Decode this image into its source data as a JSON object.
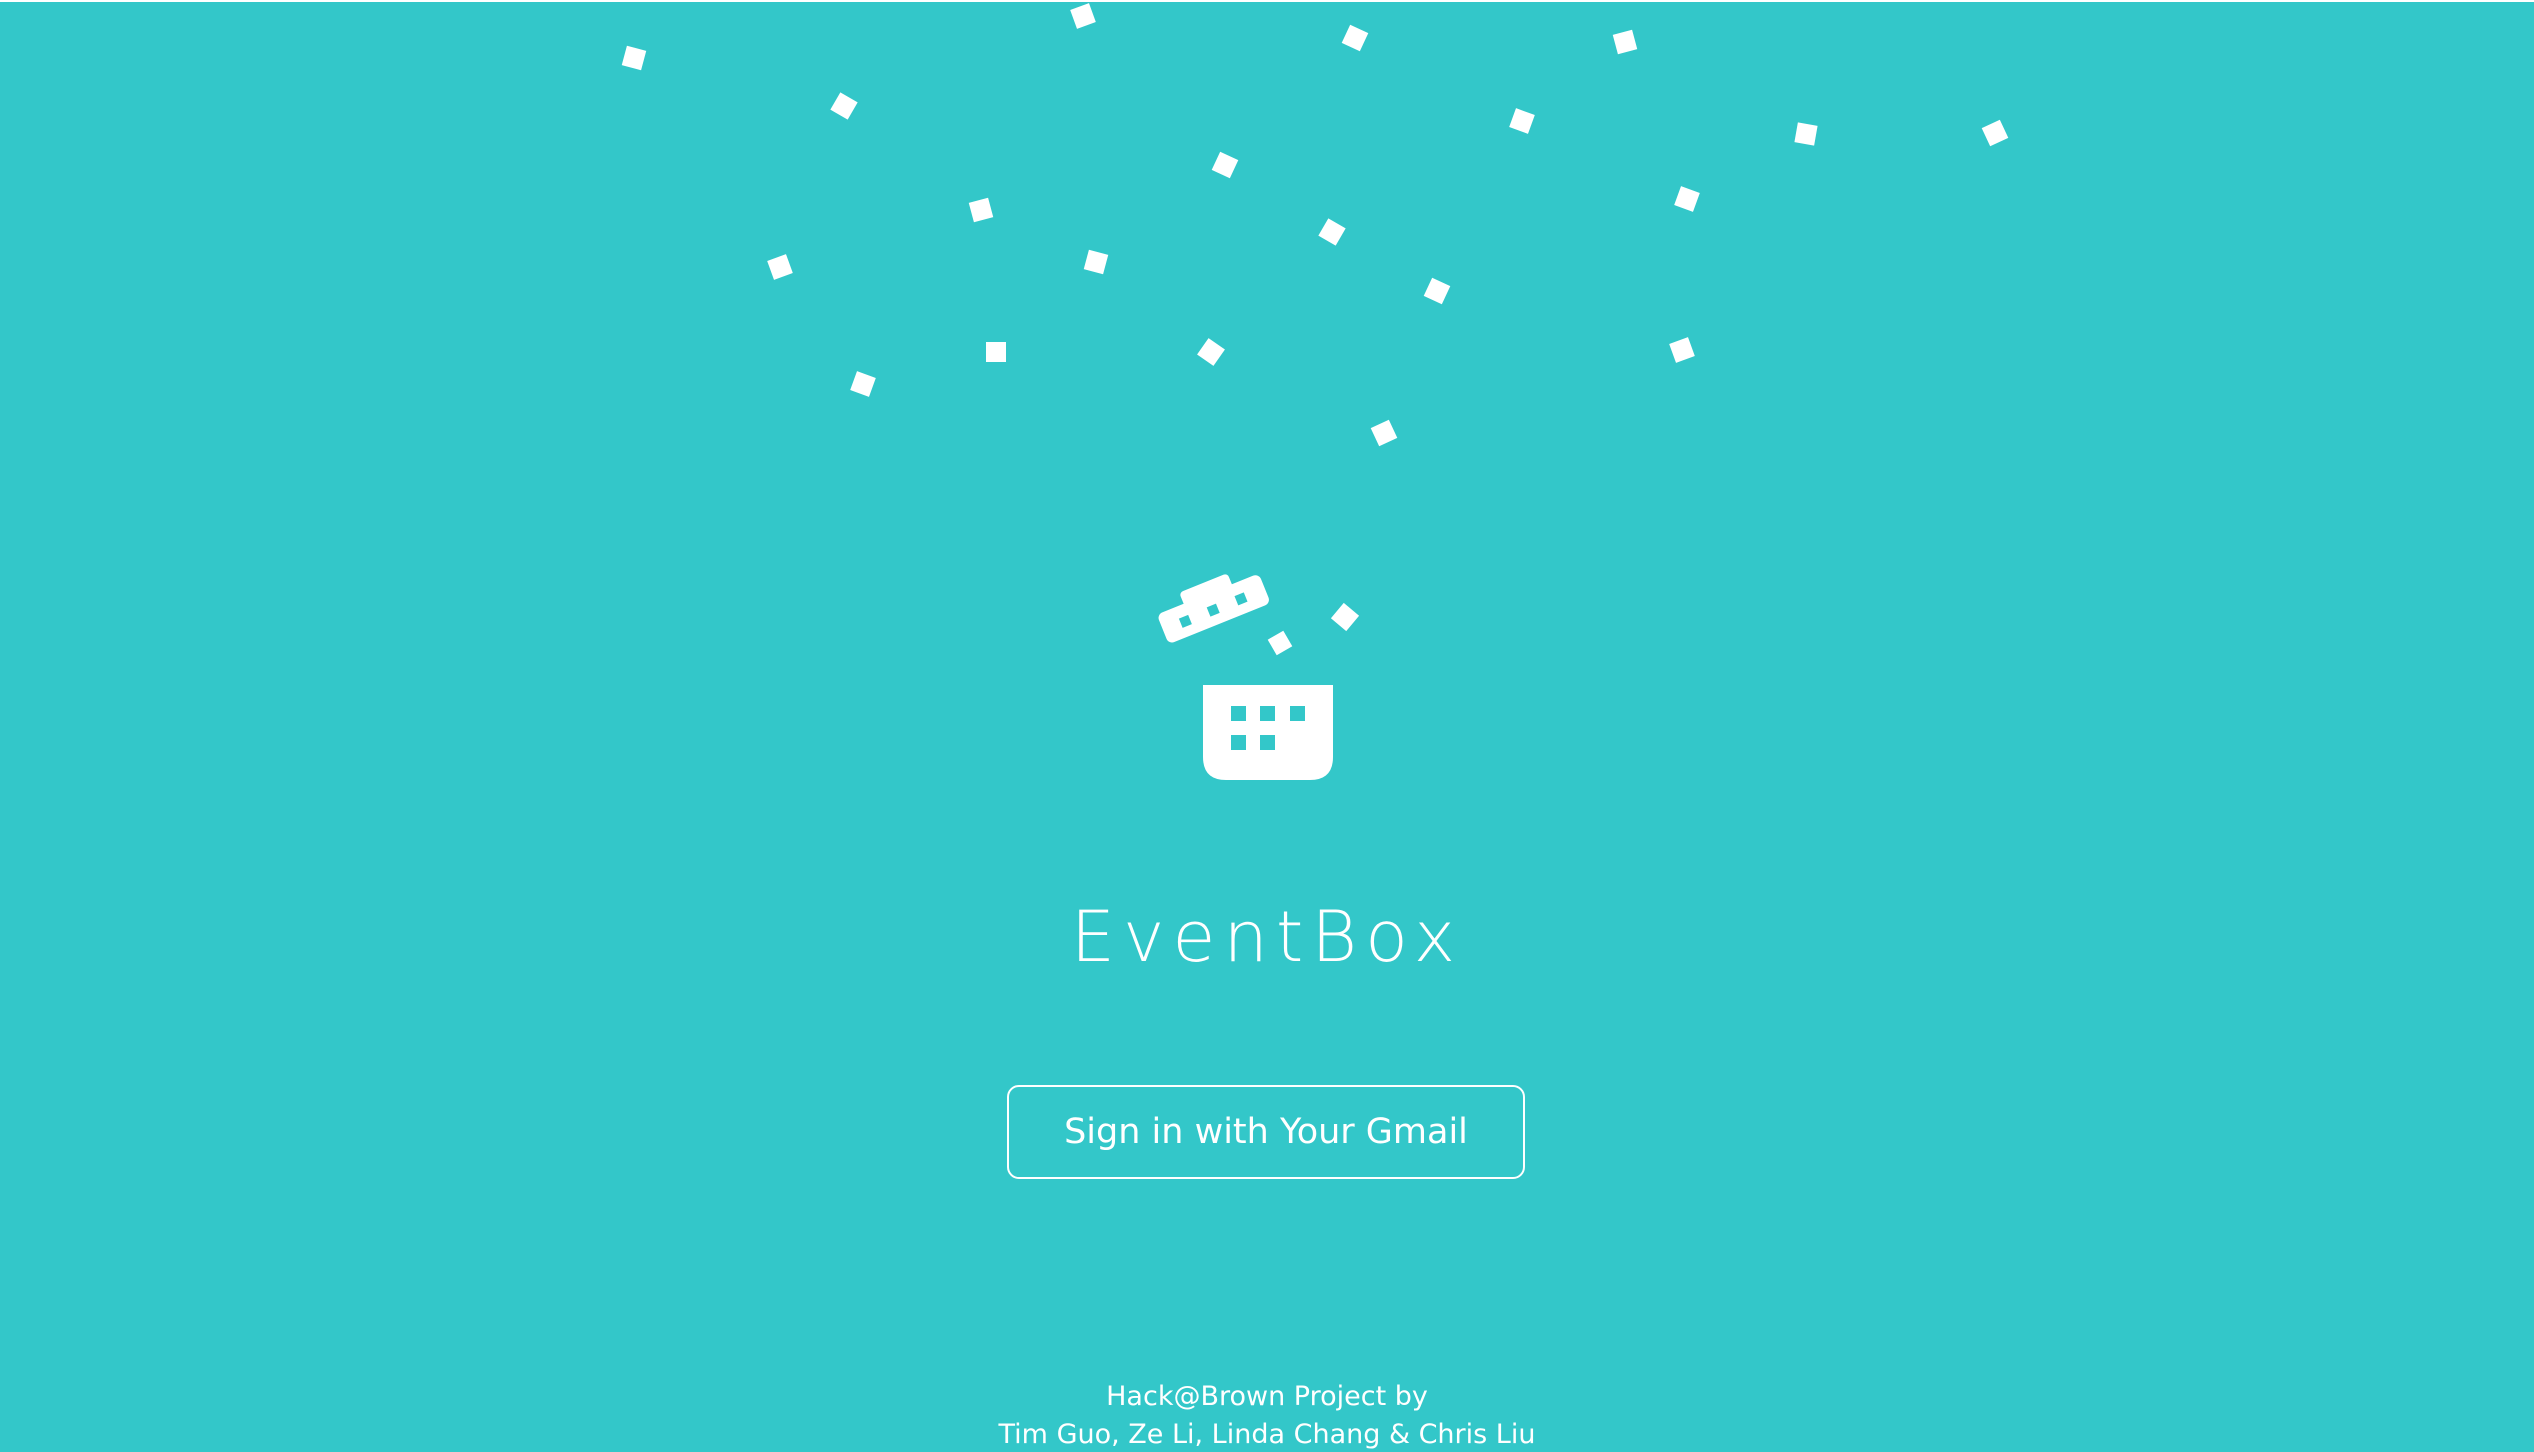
{
  "colors": {
    "background": "#33c7c9",
    "foreground": "#ffffff"
  },
  "logo": {
    "icon": "open-gift-box-calendar-icon"
  },
  "app": {
    "title": "EventBox"
  },
  "auth": {
    "signin_label": "Sign in with Your Gmail"
  },
  "footer": {
    "line1": "Hack@Brown Project by",
    "line2": "Tim Guo, Ze Li, Linda Chang & Chris Liu"
  }
}
